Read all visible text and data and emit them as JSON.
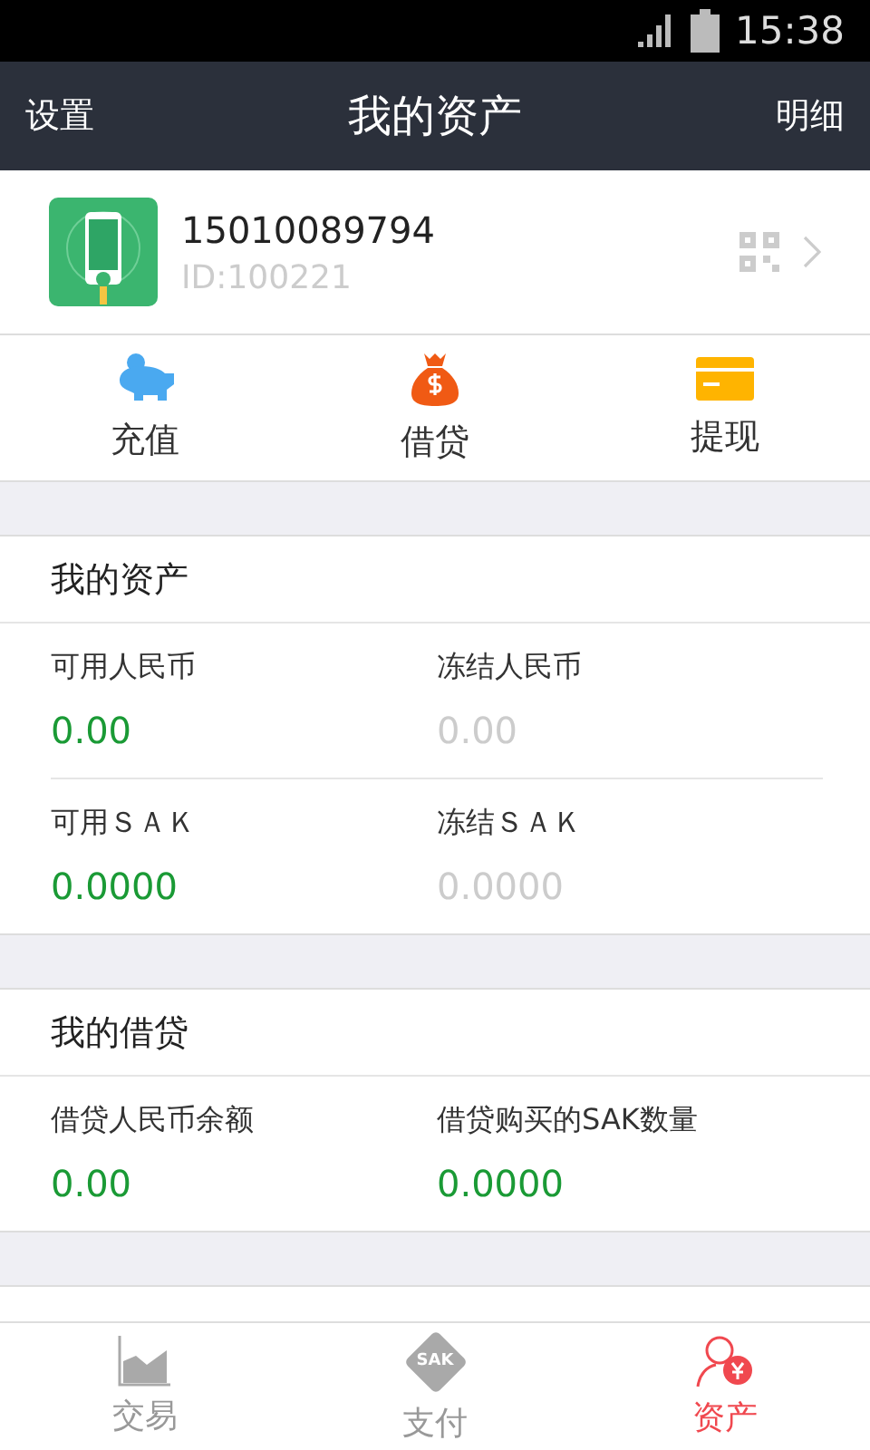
{
  "status_bar": {
    "time": "15:38"
  },
  "header": {
    "left": "设置",
    "title": "我的资产",
    "right": "明细"
  },
  "profile": {
    "phone": "15010089794",
    "id": "ID:100221"
  },
  "actions": [
    {
      "kind": "deposit",
      "label": "充值"
    },
    {
      "kind": "loan",
      "label": "借贷"
    },
    {
      "kind": "withdraw",
      "label": "提现"
    }
  ],
  "sections": [
    {
      "title": "我的资产",
      "rows": [
        [
          {
            "label": "可用人民币",
            "value": "0.00",
            "kind": "available"
          },
          {
            "label": "冻结人民币",
            "value": "0.00",
            "kind": "frozen"
          }
        ],
        [
          {
            "label": "可用ＳＡＫ",
            "value": "0.0000",
            "kind": "available"
          },
          {
            "label": "冻结ＳＡＫ",
            "value": "0.0000",
            "kind": "frozen"
          }
        ]
      ]
    },
    {
      "title": "我的借贷",
      "rows": [
        [
          {
            "label": "借贷人民币余额",
            "value": "0.00",
            "kind": "available"
          },
          {
            "label": "借贷购买的SAK数量",
            "value": "0.0000",
            "kind": "available"
          }
        ]
      ]
    }
  ],
  "tabs": [
    {
      "kind": "trade",
      "label": "交易",
      "selected": false
    },
    {
      "kind": "pay",
      "label": "支付",
      "icon_text": "SAK",
      "selected": false
    },
    {
      "kind": "assets",
      "label": "资产",
      "selected": true
    }
  ]
}
